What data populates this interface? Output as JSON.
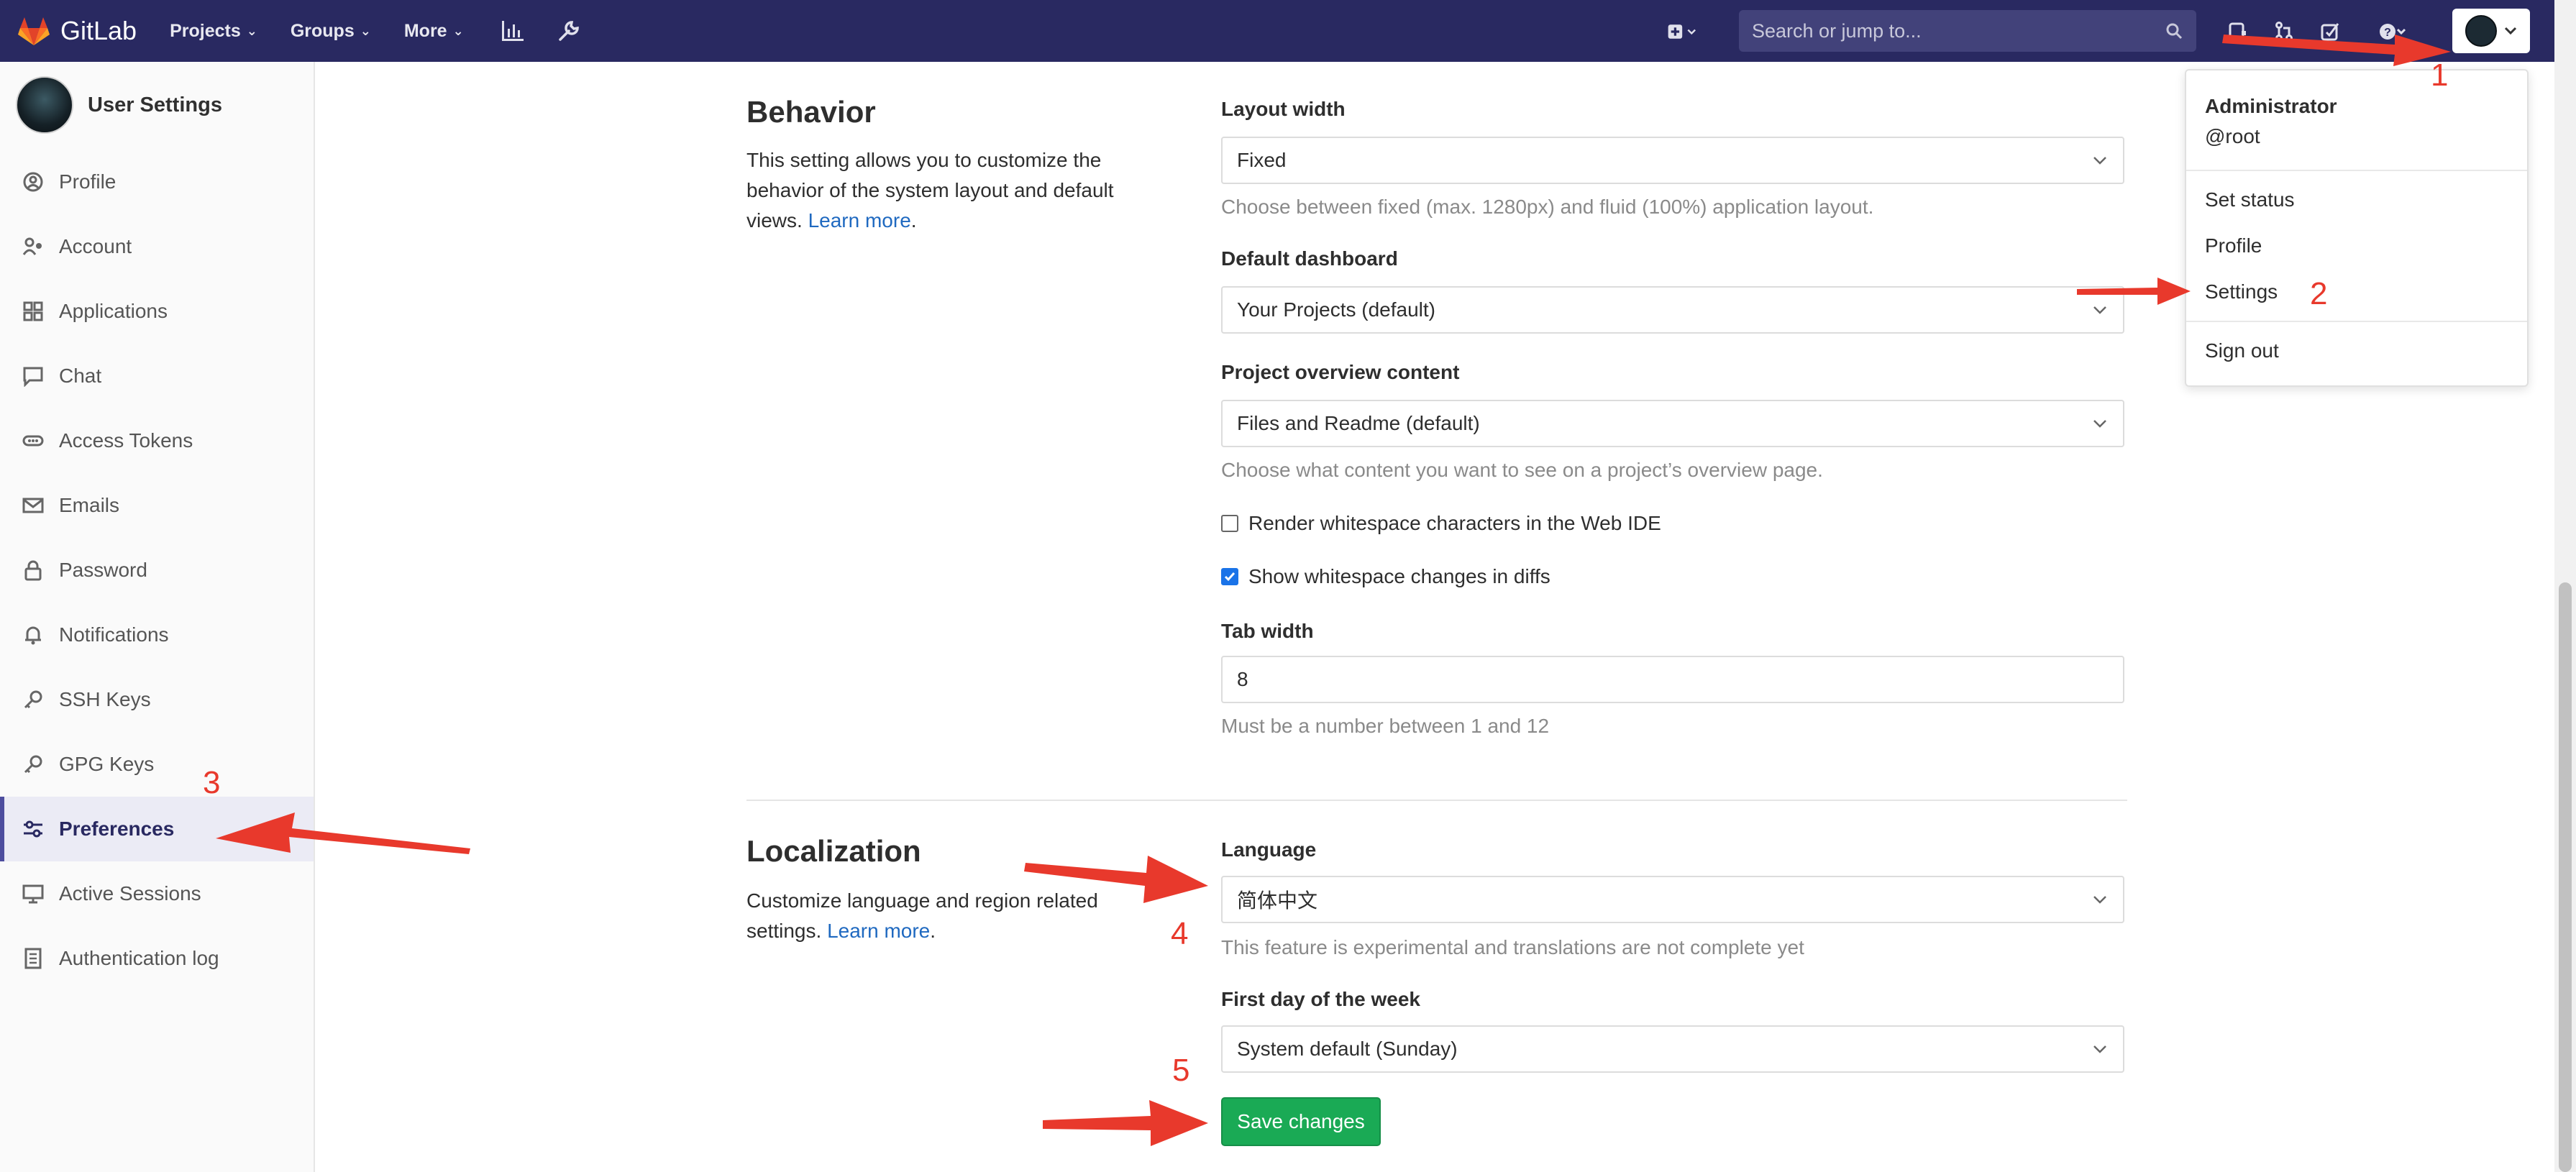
{
  "navbar": {
    "brand": "GitLab",
    "links": [
      {
        "label": "Projects"
      },
      {
        "label": "Groups"
      },
      {
        "label": "More"
      }
    ],
    "search_placeholder": "Search or jump to..."
  },
  "sidebar": {
    "title": "User Settings",
    "items": [
      {
        "label": "Profile",
        "icon": "profile-icon"
      },
      {
        "label": "Account",
        "icon": "account-icon"
      },
      {
        "label": "Applications",
        "icon": "applications-icon"
      },
      {
        "label": "Chat",
        "icon": "chat-icon"
      },
      {
        "label": "Access Tokens",
        "icon": "token-icon"
      },
      {
        "label": "Emails",
        "icon": "email-icon"
      },
      {
        "label": "Password",
        "icon": "lock-icon"
      },
      {
        "label": "Notifications",
        "icon": "bell-icon"
      },
      {
        "label": "SSH Keys",
        "icon": "key-icon"
      },
      {
        "label": "GPG Keys",
        "icon": "key-icon"
      },
      {
        "label": "Preferences",
        "icon": "preferences-icon",
        "active": true
      },
      {
        "label": "Active Sessions",
        "icon": "monitor-icon"
      },
      {
        "label": "Authentication log",
        "icon": "log-icon"
      }
    ]
  },
  "behavior": {
    "title": "Behavior",
    "desc_line1": "This setting allows you to customize the",
    "desc_line2": "behavior of the system layout and default",
    "desc_line3_prefix": "views. ",
    "learn_more": "Learn more",
    "layout_width_label": "Layout width",
    "layout_width_value": "Fixed",
    "layout_width_help": "Choose between fixed (max. 1280px) and fluid (100%) application layout.",
    "dashboard_label": "Default dashboard",
    "dashboard_value": "Your Projects (default)",
    "overview_label": "Project overview content",
    "overview_value": "Files and Readme (default)",
    "overview_help": "Choose what content you want to see on a project’s overview page.",
    "render_whitespace_label": "Render whitespace characters in the Web IDE",
    "render_whitespace_checked": false,
    "show_whitespace_label": "Show whitespace changes in diffs",
    "show_whitespace_checked": true,
    "tab_width_label": "Tab width",
    "tab_width_value": "8",
    "tab_width_help": "Must be a number between 1 and 12"
  },
  "localization": {
    "title": "Localization",
    "desc_line1": "Customize language and region related",
    "desc_line2_prefix": "settings. ",
    "learn_more": "Learn more",
    "language_label": "Language",
    "language_value": "简体中文",
    "language_help": "This feature is experimental and translations are not complete yet",
    "first_day_label": "First day of the week",
    "first_day_value": "System default (Sunday)",
    "save_label": "Save changes"
  },
  "user_menu": {
    "name": "Administrator",
    "username": "@root",
    "items": [
      "Set status",
      "Profile",
      "Settings",
      "Sign out"
    ]
  },
  "annotations": [
    "1",
    "2",
    "3",
    "4",
    "5"
  ],
  "colors": {
    "navbar": "#292961",
    "accent": "#4d4d9e",
    "save_button": "#1aaa55",
    "link": "#1f69c0",
    "annotation": "#e8392c"
  }
}
